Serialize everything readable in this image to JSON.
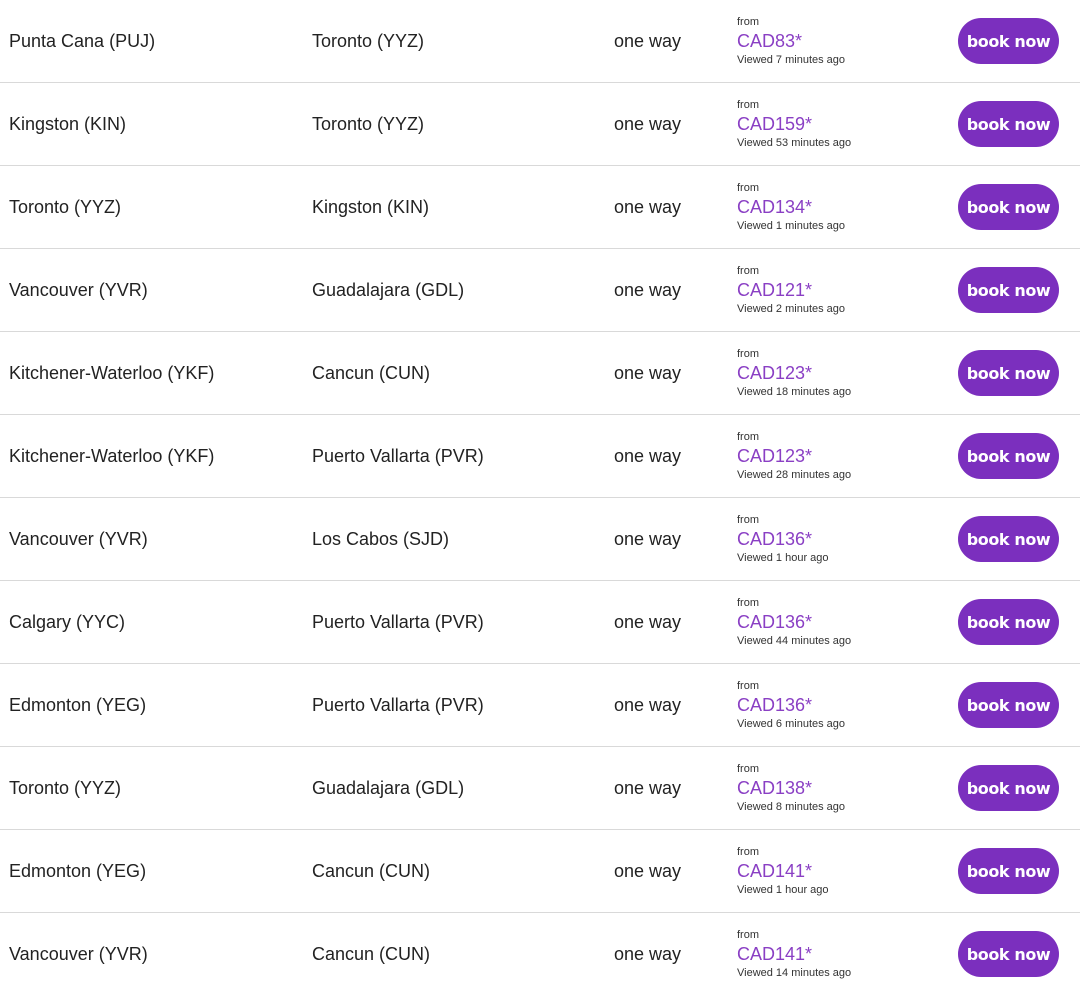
{
  "colors": {
    "accent": "#7b2fbe",
    "price": "#8a3fc4",
    "divider": "#d9d9d9",
    "text": "#222222"
  },
  "fares": [
    {
      "origin": "Punta Cana (PUJ)",
      "destination": "Toronto (YYZ)",
      "trip_type": "one way",
      "from_label": "from",
      "price": "CAD83*",
      "viewed": "Viewed 7 minutes ago",
      "button_label": "book now"
    },
    {
      "origin": "Kingston (KIN)",
      "destination": "Toronto (YYZ)",
      "trip_type": "one way",
      "from_label": "from",
      "price": "CAD159*",
      "viewed": "Viewed 53 minutes ago",
      "button_label": "book now"
    },
    {
      "origin": "Toronto (YYZ)",
      "destination": "Kingston (KIN)",
      "trip_type": "one way",
      "from_label": "from",
      "price": "CAD134*",
      "viewed": "Viewed 1 minutes ago",
      "button_label": "book now"
    },
    {
      "origin": "Vancouver (YVR)",
      "destination": "Guadalajara (GDL)",
      "trip_type": "one way",
      "from_label": "from",
      "price": "CAD121*",
      "viewed": "Viewed 2 minutes ago",
      "button_label": "book now"
    },
    {
      "origin": "Kitchener-Waterloo (YKF)",
      "destination": "Cancun (CUN)",
      "trip_type": "one way",
      "from_label": "from",
      "price": "CAD123*",
      "viewed": "Viewed 18 minutes ago",
      "button_label": "book now"
    },
    {
      "origin": "Kitchener-Waterloo (YKF)",
      "destination": "Puerto Vallarta (PVR)",
      "trip_type": "one way",
      "from_label": "from",
      "price": "CAD123*",
      "viewed": "Viewed 28 minutes ago",
      "button_label": "book now"
    },
    {
      "origin": "Vancouver (YVR)",
      "destination": "Los Cabos (SJD)",
      "trip_type": "one way",
      "from_label": "from",
      "price": "CAD136*",
      "viewed": "Viewed 1 hour ago",
      "button_label": "book now"
    },
    {
      "origin": "Calgary (YYC)",
      "destination": "Puerto Vallarta (PVR)",
      "trip_type": "one way",
      "from_label": "from",
      "price": "CAD136*",
      "viewed": "Viewed 44 minutes ago",
      "button_label": "book now"
    },
    {
      "origin": "Edmonton (YEG)",
      "destination": "Puerto Vallarta (PVR)",
      "trip_type": "one way",
      "from_label": "from",
      "price": "CAD136*",
      "viewed": "Viewed 6 minutes ago",
      "button_label": "book now"
    },
    {
      "origin": "Toronto (YYZ)",
      "destination": "Guadalajara (GDL)",
      "trip_type": "one way",
      "from_label": "from",
      "price": "CAD138*",
      "viewed": "Viewed 8 minutes ago",
      "button_label": "book now"
    },
    {
      "origin": "Edmonton (YEG)",
      "destination": "Cancun (CUN)",
      "trip_type": "one way",
      "from_label": "from",
      "price": "CAD141*",
      "viewed": "Viewed 1 hour ago",
      "button_label": "book now"
    },
    {
      "origin": "Vancouver (YVR)",
      "destination": "Cancun (CUN)",
      "trip_type": "one way",
      "from_label": "from",
      "price": "CAD141*",
      "viewed": "Viewed 14 minutes ago",
      "button_label": "book now"
    }
  ]
}
